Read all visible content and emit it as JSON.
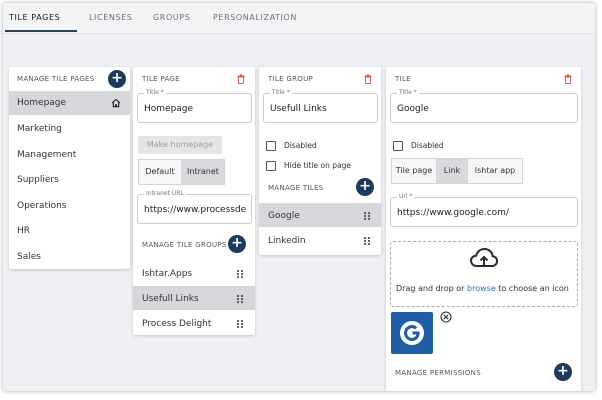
{
  "tabs": [
    {
      "label": "TILE PAGES",
      "active": true
    },
    {
      "label": "LICENSES",
      "active": false
    },
    {
      "label": "GROUPS",
      "active": false
    },
    {
      "label": "PERSONALIZATION",
      "active": false
    }
  ],
  "tile_pages_panel": {
    "title": "MANAGE TILE PAGES",
    "items": [
      "Homepage",
      "Marketing",
      "Management",
      "Suppliers",
      "Operations",
      "HR",
      "Sales"
    ],
    "selected": "Homepage"
  },
  "tile_page_panel": {
    "title": "TILE PAGE",
    "title_field_label": "Title *",
    "title_value": "Homepage",
    "make_homepage_label": "Make homepage",
    "segments": [
      "Default",
      "Intranet"
    ],
    "active_segment": "Intranet",
    "intranet_url_label": "Intranet URL",
    "intranet_url_value": "https://www.processde",
    "manage_groups_title": "MANAGE TILE GROUPS",
    "groups": [
      "Ishtar.Apps",
      "Usefull Links",
      "Process Delight"
    ],
    "selected_group": "Usefull Links"
  },
  "tile_group_panel": {
    "title": "TILE GROUP",
    "title_field_label": "Title *",
    "title_value": "Usefull Links",
    "disabled_label": "Disabled",
    "hide_title_label": "Hide title on page",
    "manage_tiles_title": "MANAGE TILES",
    "tiles": [
      "Google",
      "Linkedin"
    ],
    "selected_tile": "Google"
  },
  "tile_panel": {
    "title": "TILE",
    "title_field_label": "Title *",
    "title_value": "Google",
    "disabled_label": "Disabled",
    "segments": [
      "Tile page",
      "Link",
      "Ishtar app"
    ],
    "active_segment": "Link",
    "url_label": "Url *",
    "url_value": "https://www.google.com/",
    "drop_prefix": "Drag and drop or",
    "drop_link": "browse",
    "drop_suffix": "to choose an icon",
    "manage_permissions_title": "MANAGE PERMISSIONS"
  },
  "colors": {
    "accent": "#1e3a5a",
    "trash": "#e25b45",
    "selected_row": "#d5d7da",
    "link": "#2f6fb3",
    "google_tile": "#1f5fa8"
  },
  "icons": [
    "home-icon",
    "trash-icon",
    "plus-icon",
    "drag-handle-icon",
    "cloud-upload-icon",
    "close-circle-icon",
    "google-icon"
  ]
}
